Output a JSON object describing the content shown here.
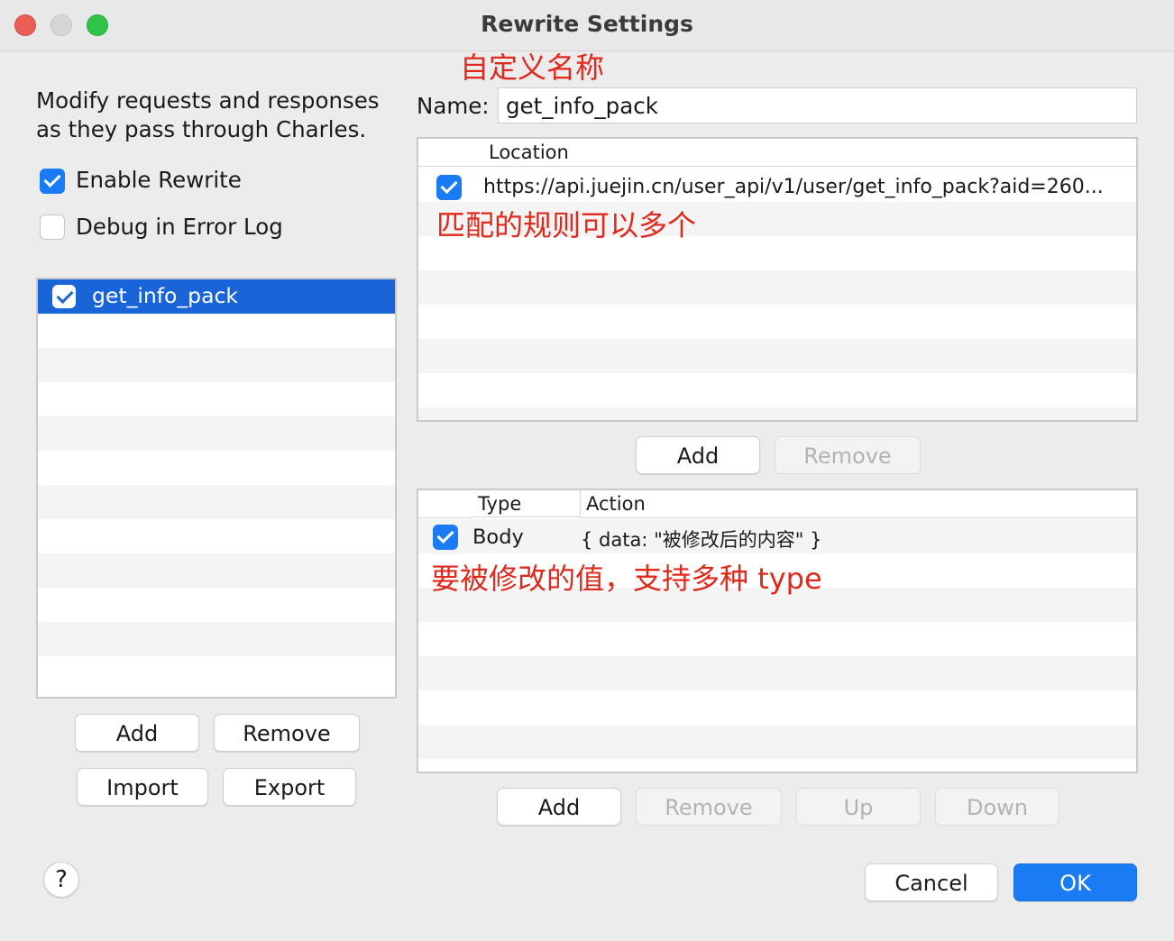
{
  "window": {
    "title": "Rewrite Settings"
  },
  "annotations": {
    "name_note": "自定义名称",
    "location_note": "匹配的规则可以多个",
    "action_note": "要被修改的值，支持多种 type"
  },
  "description": {
    "line1": "Modify requests and responses",
    "line2": "as they pass through Charles."
  },
  "options": {
    "enable_rewrite": {
      "label": "Enable Rewrite",
      "checked": true
    },
    "debug_error_log": {
      "label": "Debug in Error Log",
      "checked": false
    }
  },
  "sets": {
    "items": [
      {
        "label": "get_info_pack",
        "checked": true,
        "selected": true
      }
    ],
    "buttons": {
      "add": "Add",
      "remove": "Remove",
      "import": "Import",
      "export": "Export"
    }
  },
  "name_field": {
    "label": "Name:",
    "value": "get_info_pack"
  },
  "locations": {
    "header": "Location",
    "rows": [
      {
        "checked": true,
        "url": "https://api.juejin.cn/user_api/v1/user/get_info_pack?aid=260..."
      }
    ],
    "buttons": {
      "add": "Add",
      "remove": "Remove"
    }
  },
  "rules": {
    "headers": {
      "type": "Type",
      "action": "Action"
    },
    "rows": [
      {
        "checked": true,
        "type": "Body",
        "action": "{ data: \"被修改后的内容\" }"
      }
    ],
    "buttons": {
      "add": "Add",
      "remove": "Remove",
      "up": "Up",
      "down": "Down"
    }
  },
  "footer": {
    "help": "?",
    "cancel": "Cancel",
    "ok": "OK"
  },
  "colors": {
    "accent": "#1a7cf5",
    "annotation": "#e0291c",
    "selection": "#1964d8"
  }
}
